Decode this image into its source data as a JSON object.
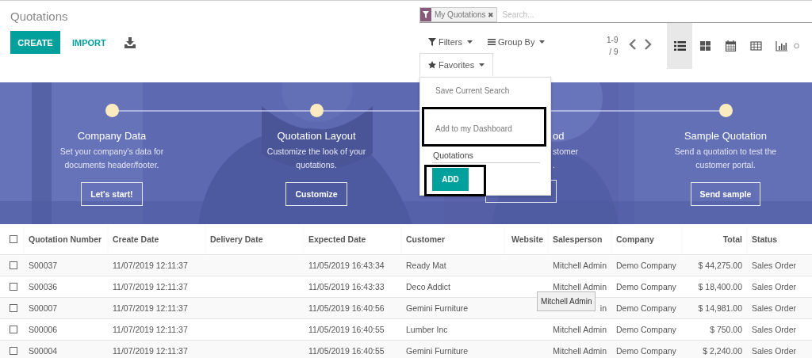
{
  "title": "Quotations",
  "actions": {
    "create": "CREATE",
    "import": "IMPORT"
  },
  "search": {
    "facets": [
      {
        "label": "My Quotations",
        "remove": "✖"
      }
    ],
    "placeholder": "Search..."
  },
  "search_options": [
    {
      "kind": "filter",
      "label": "Filters",
      "expanded": false
    },
    {
      "kind": "group",
      "label": "Group By",
      "expanded": false
    },
    {
      "kind": "favorite",
      "label": "Favorites",
      "expanded": true
    }
  ],
  "pager": {
    "range": "1-9",
    "total": "/ 9"
  },
  "views": [
    {
      "kind": "list",
      "selected": true
    },
    {
      "kind": "kanban",
      "selected": false
    },
    {
      "kind": "calendar",
      "selected": false
    },
    {
      "kind": "pivot",
      "selected": false
    },
    {
      "kind": "graph",
      "selected": false
    },
    {
      "kind": "activity",
      "selected": false
    }
  ],
  "onboarding": {
    "steps": [
      {
        "kind": "full",
        "title": "Company Data",
        "description_lines": [
          "Set your company's data for",
          "documents header/footer."
        ],
        "button": "Let's start!"
      },
      {
        "kind": "full",
        "title": "Quotation Layout",
        "description_lines": [
          "Customize the look of your",
          "quotations."
        ],
        "button": "Customize"
      },
      {
        "kind": "covered",
        "title": "od",
        "description_lines": [
          "stomer",
          "."
        ]
      },
      {
        "kind": "full",
        "title": "Sample Quotation",
        "description_lines": [
          "Send a quotation to test the",
          "customer portal."
        ],
        "button": "Send sample"
      }
    ]
  },
  "favorites_menu": {
    "items": [
      {
        "label": "Save Current Search",
        "highlighted": false
      },
      {
        "label": "Add to my Dashboard",
        "highlighted": true
      }
    ],
    "dashboard_name": "Quotations",
    "add": "ADD",
    "add_highlighted": true
  },
  "table": {
    "all_selected": false,
    "columns": [
      "Quotation Number",
      "Create Date",
      "Delivery Date",
      "Expected Date",
      "Customer",
      "Website",
      "Salesperson",
      "Company",
      "Total",
      "Status"
    ],
    "rows": [
      {
        "selected": false,
        "number": "S00037",
        "create_date": "11/07/2019 12:11:37",
        "expected_date": "11/05/2019 16:43:34",
        "customer": "Ready Mat",
        "salesperson": "Mitchell Admin",
        "company": "Demo Company",
        "total": "$ 44,275.00",
        "status": "Sales Order"
      },
      {
        "selected": false,
        "number": "S00036",
        "create_date": "11/07/2019 12:11:37",
        "expected_date": "11/05/2019 16:43:33",
        "customer": "Deco Addict",
        "salesperson": "Mitchell Admin",
        "company": "Demo Company",
        "total": "$ 18,400.00",
        "status": "Sales Order"
      },
      {
        "selected": false,
        "number": "S00007",
        "create_date": "11/07/2019 12:11:37",
        "expected_date": "11/05/2019 16:40:56",
        "customer": "Gemini Furniture",
        "salesperson": "in",
        "company": "Demo Company",
        "total": "$ 14,981.00",
        "status": "Sales Order"
      },
      {
        "selected": false,
        "number": "S00006",
        "create_date": "11/07/2019 12:11:37",
        "expected_date": "11/05/2019 16:40:55",
        "customer": "Lumber Inc",
        "salesperson": "Mitchell Admin",
        "company": "Demo Company",
        "total": "$ 750.00",
        "status": "Sales Order"
      },
      {
        "selected": false,
        "number": "S00004",
        "create_date": "11/07/2019 12:11:37",
        "expected_date": "11/05/2019 16:40:55",
        "customer": "Gemini Furniture",
        "salesperson": "Mitchell Admin",
        "company": "Demo Company",
        "total": "$ 2,240.00",
        "status": "Sales Order"
      }
    ]
  },
  "tooltip": "Mitchell Admin"
}
